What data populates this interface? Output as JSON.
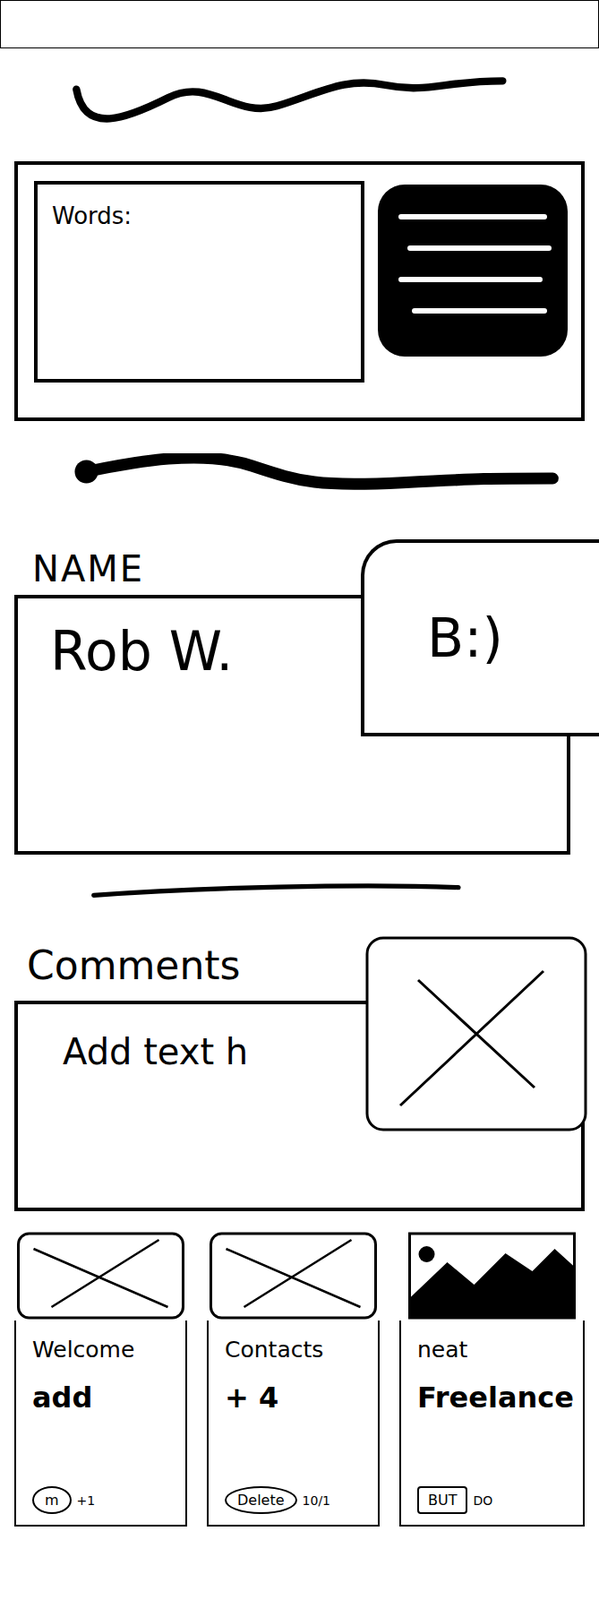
{
  "words_panel": {
    "label": "Words:"
  },
  "name_panel": {
    "label": "NAME",
    "value": "Rob W.",
    "badge": "B:)"
  },
  "comments_panel": {
    "label": "Comments",
    "placeholder": "Add text h"
  },
  "cards": [
    {
      "title": "Welcome",
      "body": "add",
      "image": "placeholder",
      "actions": [
        {
          "label": "m",
          "kind": "oval"
        },
        {
          "label": "+1",
          "kind": "plain"
        }
      ]
    },
    {
      "title": "Contacts",
      "body": "+ 4",
      "image": "placeholder",
      "actions": [
        {
          "label": "Delete",
          "kind": "oval"
        },
        {
          "label": "10/1",
          "kind": "plain"
        }
      ]
    },
    {
      "title": "neat",
      "body": "Freelance",
      "image": "photo",
      "actions": [
        {
          "label": "BUT",
          "kind": "box"
        },
        {
          "label": "DO",
          "kind": "plain"
        }
      ]
    }
  ]
}
